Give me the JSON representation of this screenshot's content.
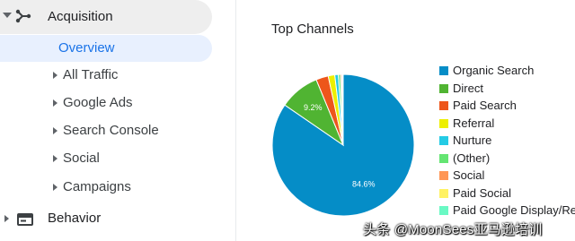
{
  "sidebar": {
    "acquisition": {
      "label": "Acquisition"
    },
    "overview": {
      "label": "Overview"
    },
    "items": [
      {
        "label": "All Traffic"
      },
      {
        "label": "Google Ads"
      },
      {
        "label": "Search Console"
      },
      {
        "label": "Social"
      },
      {
        "label": "Campaigns"
      }
    ],
    "behavior": {
      "label": "Behavior"
    }
  },
  "main": {
    "title": "Top Channels"
  },
  "chart_data": {
    "type": "pie",
    "title": "Top Channels",
    "slices": [
      {
        "label": "Organic Search",
        "value": 84.6,
        "color": "#058dc7",
        "data_label": "84.6%"
      },
      {
        "label": "Direct",
        "value": 9.2,
        "color": "#50b432",
        "data_label": "9.2%"
      },
      {
        "label": "Paid Search",
        "value": 2.8,
        "color": "#ed561b",
        "data_label": ""
      },
      {
        "label": "Referral",
        "value": 1.5,
        "color": "#edef00",
        "data_label": ""
      },
      {
        "label": "Nurture",
        "value": 0.8,
        "color": "#24cbe5",
        "data_label": ""
      },
      {
        "label": "(Other)",
        "value": 0.5,
        "color": "#64e572",
        "data_label": ""
      },
      {
        "label": "Social",
        "value": 0.3,
        "color": "#ff9655",
        "data_label": ""
      },
      {
        "label": "Paid Social",
        "value": 0.2,
        "color": "#fff263",
        "data_label": ""
      },
      {
        "label": "Paid Google Display/Re",
        "value": 0.1,
        "color": "#6af9c4",
        "data_label": ""
      }
    ],
    "legend_position": "right"
  },
  "watermark": {
    "text": "头条 @MoonSees亚马逊培训"
  },
  "icons": {
    "caret": "caret-down-icon",
    "acquisition": "acquisition-icon",
    "behavior": "behavior-icon"
  }
}
